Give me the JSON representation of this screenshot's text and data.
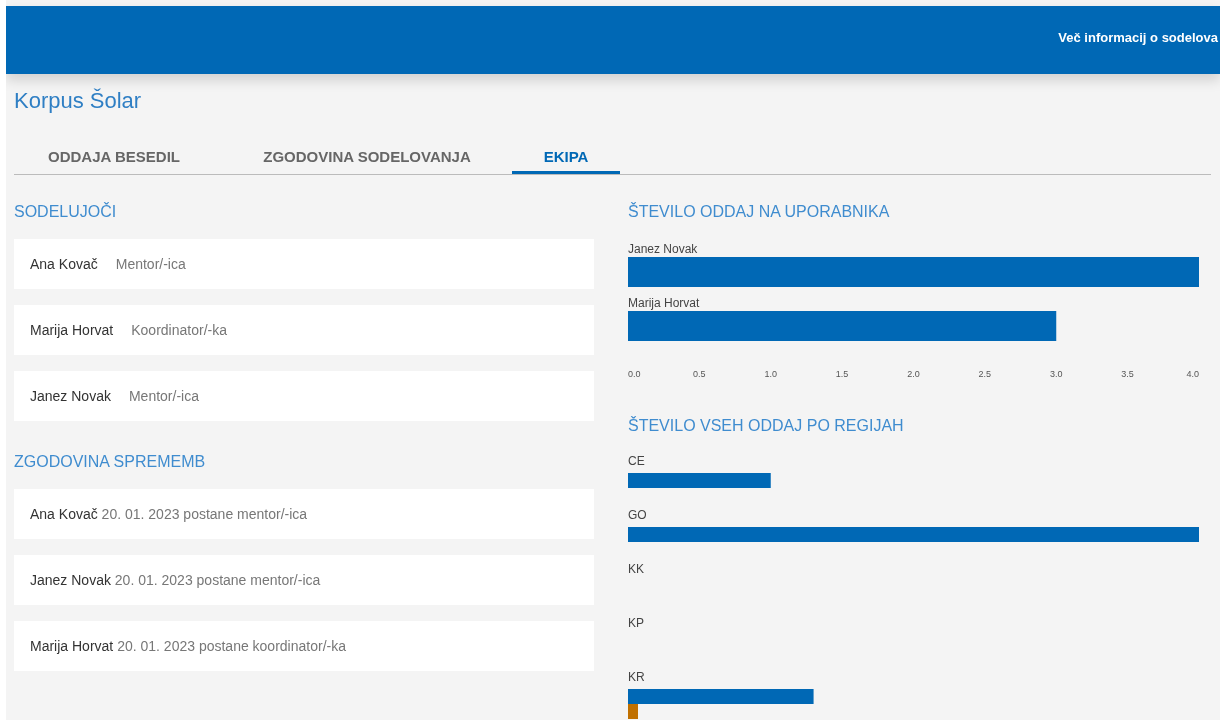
{
  "header": {
    "link": "Več informacij o sodelova"
  },
  "title": "Korpus Šolar",
  "tabs": [
    {
      "label": "ODDAJA BESEDIL",
      "selected": false
    },
    {
      "label": "ZGODOVINA SODELOVANJA",
      "selected": false
    },
    {
      "label": "EKIPA",
      "selected": true
    }
  ],
  "participants": {
    "heading": "SODELUJOČI",
    "items": [
      {
        "name": "Ana Kovač",
        "role": "Mentor/-ica"
      },
      {
        "name": "Marija Horvat",
        "role": "Koordinator/-ka"
      },
      {
        "name": "Janez Novak",
        "role": "Mentor/-ica"
      }
    ]
  },
  "history": {
    "heading": "ZGODOVINA SPREMEMB",
    "items": [
      {
        "name": "Ana Kovač",
        "change": "20. 01. 2023 postane mentor/-ica"
      },
      {
        "name": "Janez Novak",
        "change": "20. 01. 2023 postane mentor/-ica"
      },
      {
        "name": "Marija Horvat",
        "change": "20. 01. 2023 postane koordinator/-ka"
      }
    ]
  },
  "user_chart": {
    "chart_data": {
      "type": "bar",
      "orientation": "horizontal",
      "title": "ŠTEVILO ODDAJ NA UPORABNIKA",
      "categories": [
        "Janez Novak",
        "Marija Horvat"
      ],
      "series": [
        {
          "color": "#0068b5",
          "values": [
            4,
            3
          ]
        }
      ],
      "xlim": [
        0,
        4
      ],
      "xticks": [
        {
          "value": 0,
          "label": "0.0"
        },
        {
          "value": 0.5,
          "label": "0.5"
        },
        {
          "value": 1,
          "label": "1.0"
        },
        {
          "value": 1.5,
          "label": "1.5"
        },
        {
          "value": 2,
          "label": "2.0"
        },
        {
          "value": 2.5,
          "label": "2.5"
        },
        {
          "value": 3,
          "label": "3.0"
        },
        {
          "value": 3.5,
          "label": "3.5"
        },
        {
          "value": 4,
          "label": "4.0"
        }
      ]
    }
  },
  "region_chart": {
    "chart_data": {
      "type": "bar",
      "orientation": "horizontal",
      "title": "ŠTEVILO VSEH ODDAJ PO REGIJAH",
      "categories": [
        "CE",
        "GO",
        "KK",
        "KP",
        "KR"
      ],
      "series": [
        {
          "color": "#0068b5",
          "values": [
            1,
            4,
            0,
            0,
            1.3
          ]
        },
        {
          "color": "#c07000",
          "values": [
            null,
            null,
            null,
            null,
            0.07
          ]
        }
      ],
      "xlim": [
        0,
        4
      ]
    }
  }
}
